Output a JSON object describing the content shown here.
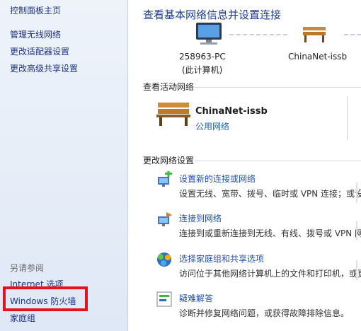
{
  "sidebar": {
    "home": "控制面板主页",
    "links": [
      "管理无线网络",
      "更改适配器设置",
      "更改高级共享设置"
    ],
    "see_also_label": "另请参阅",
    "see_also": [
      "Internet 选项",
      "Windows 防火墙",
      "家庭组"
    ]
  },
  "main": {
    "title": "查看基本网络信息并设置连接",
    "computer_name": "258963-PC",
    "computer_sub": "(此计算机)",
    "network_node": "ChinaNet-issb",
    "active_header": "查看活动网络",
    "active_network": {
      "name": "ChinaNet-issb",
      "type": "公用网络"
    },
    "change_header": "更改网络设置",
    "options": [
      {
        "icon": "network-setup-icon",
        "link": "设置新的连接或网络",
        "desc": "设置无线、宽带、拨号、临时或 VPN 连接；或设"
      },
      {
        "icon": "connect-network-icon",
        "link": "连接到网络",
        "desc": "连接到或重新连接到无线、有线、拨号或 VPN 网"
      },
      {
        "icon": "homegroup-icon",
        "link": "选择家庭组和共享选项",
        "desc": "访问位于其他网络计算机上的文件和打印机，或更"
      },
      {
        "icon": "troubleshoot-icon",
        "link": "疑难解答",
        "desc": "诊断并修复网络问题，或获得故障排除信息。"
      }
    ]
  },
  "colors": {
    "highlight_box": "#e3131d",
    "link": "#1e50b4",
    "title": "#1e3c91"
  }
}
